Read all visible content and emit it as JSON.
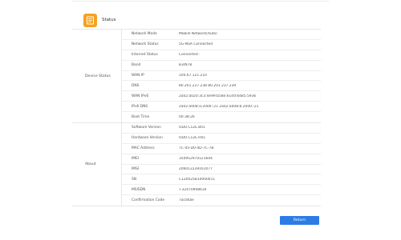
{
  "header": {
    "title": "Status",
    "icon": "status-doc-icon",
    "icon_color": "#f5a21f"
  },
  "sections": [
    {
      "label": "Device Status",
      "rows": [
        {
          "label": "Network Mode",
          "value": "Mobile Network(Auto)"
        },
        {
          "label": "Network Status",
          "value": "5G-NSA Connected"
        },
        {
          "label": "Internet Status",
          "value": "Connected -"
        },
        {
          "label": "Band",
          "value": "B3/N78"
        },
        {
          "label": "WAN IP",
          "value": "100.67.121.210"
        },
        {
          "label": "DNS",
          "value": "80.201.237.238   80.201.237.239"
        },
        {
          "label": "WAN IPv6",
          "value": "2a02:a020:3c3:4e99:b58e:61dd:6485:5936"
        },
        {
          "label": "IPv6 DNS",
          "value": "2a02:a008:a:2000::21   2a02:a008:b:2000::21"
        },
        {
          "label": "Boot Time",
          "value": "00:38:26"
        }
      ]
    },
    {
      "label": "About",
      "rows": [
        {
          "label": "Software Version",
          "value": "ODU.C12E.B01"
        },
        {
          "label": "Hardware Version",
          "value": "ODU.C12E.H01"
        },
        {
          "label": "MAC Address",
          "value": "7C-45-D0-4D-7C-7B"
        },
        {
          "label": "IMEI",
          "value": "350952970121604"
        },
        {
          "label": "IMSI",
          "value": "206012239161077"
        },
        {
          "label": "SN",
          "value": "C120025B10000011"
        },
        {
          "label": "MSISDN",
          "value": "+32470908634"
        },
        {
          "label": "Confirmation Code",
          "value": "7acd4ae"
        }
      ]
    }
  ],
  "actions": {
    "return_label": "Return",
    "accent": "#2d7be5"
  }
}
